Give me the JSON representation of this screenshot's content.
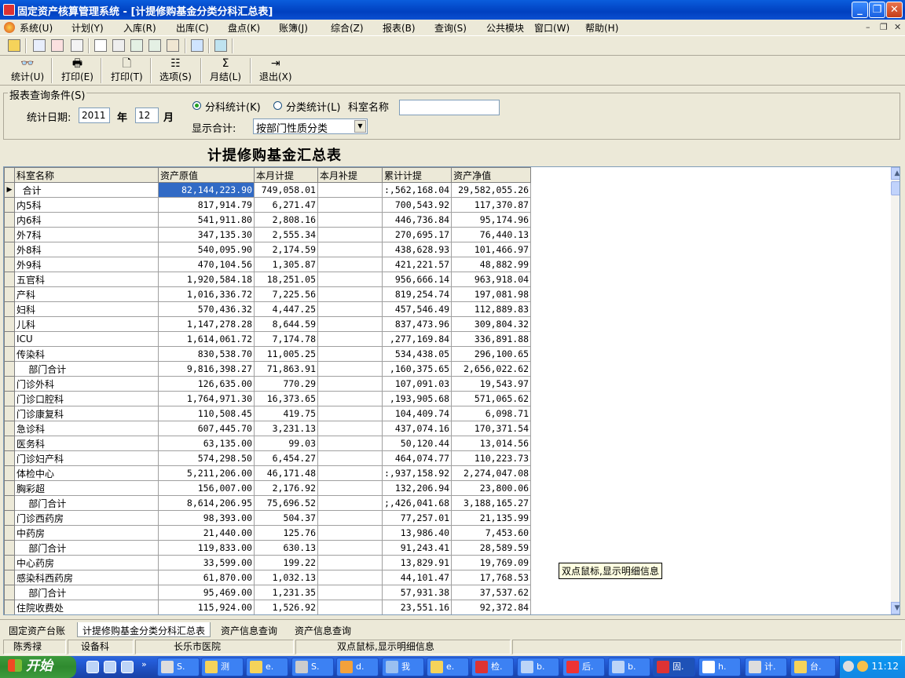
{
  "window": {
    "title": "固定资产核算管理系统 - [计提修购基金分类分科汇总表]"
  },
  "menu": [
    "系统(U)",
    "计划(Y)",
    "入库(R)",
    "出库(C)",
    "盘点(K)",
    "账簿(J)",
    "综合(Z)",
    "报表(B)",
    "查询(S)",
    "公共模块",
    "窗口(W)",
    "帮助(H)"
  ],
  "toolbar2": [
    {
      "label": "统计(U)",
      "icon": "binoculars-icon"
    },
    {
      "label": "打印(E)",
      "icon": "printer-icon"
    },
    {
      "label": "打印(T)",
      "icon": "print-preview-icon"
    },
    {
      "label": "选项(S)",
      "icon": "options-icon"
    },
    {
      "label": "月结(L)",
      "icon": "sigma-icon"
    },
    {
      "label": "退出(X)",
      "icon": "exit-door-icon"
    }
  ],
  "query": {
    "legend": "报表查询条件(S)",
    "date_label": "统计日期:",
    "year": "2011",
    "year_unit": "年",
    "month": "12",
    "month_unit": "月",
    "radio_dept": "分科统计(K)",
    "radio_class": "分类统计(L)",
    "dept_name_label": "科室名称",
    "dept_name_value": "",
    "total_label": "显示合计:",
    "total_option": "按部门性质分类"
  },
  "report": {
    "title": "计提修购基金汇总表",
    "columns": [
      "科室名称",
      "资产原值",
      "本月计提",
      "本月补提",
      "累计计提",
      "资产净值"
    ],
    "rows": [
      [
        "  合计",
        "82,144,223.90",
        "749,058.01",
        "",
        ":,562,168.04",
        "29,582,055.26"
      ],
      [
        "内5科",
        "817,914.79",
        "6,271.47",
        "",
        "700,543.92",
        "117,370.87"
      ],
      [
        "内6科",
        "541,911.80",
        "2,808.16",
        "",
        "446,736.84",
        "95,174.96"
      ],
      [
        "外7科",
        "347,135.30",
        "2,555.34",
        "",
        "270,695.17",
        "76,440.13"
      ],
      [
        "外8科",
        "540,095.90",
        "2,174.59",
        "",
        "438,628.93",
        "101,466.97"
      ],
      [
        "外9科",
        "470,104.56",
        "1,305.87",
        "",
        "421,221.57",
        "48,882.99"
      ],
      [
        "五官科",
        "1,920,584.18",
        "18,251.05",
        "",
        "956,666.14",
        "963,918.04"
      ],
      [
        "产科",
        "1,016,336.72",
        "7,225.56",
        "",
        "819,254.74",
        "197,081.98"
      ],
      [
        "妇科",
        "570,436.32",
        "4,447.25",
        "",
        "457,546.49",
        "112,889.83"
      ],
      [
        "儿科",
        "1,147,278.28",
        "8,644.59",
        "",
        "837,473.96",
        "309,804.32"
      ],
      [
        "ICU",
        "1,614,061.72",
        "7,174.78",
        "",
        ",277,169.84",
        "336,891.88"
      ],
      [
        "传染科",
        "830,538.70",
        "11,005.25",
        "",
        "534,438.05",
        "296,100.65"
      ],
      [
        "    部门合计",
        "9,816,398.27",
        "71,863.91",
        "",
        ",160,375.65",
        "2,656,022.62"
      ],
      [
        "门诊外科",
        "126,635.00",
        "770.29",
        "",
        "107,091.03",
        "19,543.97"
      ],
      [
        "门诊口腔科",
        "1,764,971.30",
        "16,373.65",
        "",
        ",193,905.68",
        "571,065.62"
      ],
      [
        "门诊康复科",
        "110,508.45",
        "419.75",
        "",
        "104,409.74",
        "6,098.71"
      ],
      [
        "急诊科",
        "607,445.70",
        "3,231.13",
        "",
        "437,074.16",
        "170,371.54"
      ],
      [
        "医务科",
        "63,135.00",
        "99.03",
        "",
        "50,120.44",
        "13,014.56"
      ],
      [
        "门诊妇产科",
        "574,298.50",
        "6,454.27",
        "",
        "464,074.77",
        "110,223.73"
      ],
      [
        "体检中心",
        "5,211,206.00",
        "46,171.48",
        "",
        ":,937,158.92",
        "2,274,047.08"
      ],
      [
        "胸彩超",
        "156,007.00",
        "2,176.92",
        "",
        "132,206.94",
        "23,800.06"
      ],
      [
        "    部门合计",
        "8,614,206.95",
        "75,696.52",
        "",
        ";,426,041.68",
        "3,188,165.27"
      ],
      [
        "门诊西药房",
        "98,393.00",
        "504.37",
        "",
        "77,257.01",
        "21,135.99"
      ],
      [
        "中药房",
        "21,440.00",
        "125.76",
        "",
        "13,986.40",
        "7,453.60"
      ],
      [
        "    部门合计",
        "119,833.00",
        "630.13",
        "",
        "91,243.41",
        "28,589.59"
      ],
      [
        "中心药房",
        "33,599.00",
        "199.22",
        "",
        "13,829.91",
        "19,769.09"
      ],
      [
        "感染科西药房",
        "61,870.00",
        "1,032.13",
        "",
        "44,101.47",
        "17,768.53"
      ],
      [
        "    部门合计",
        "95,469.00",
        "1,231.35",
        "",
        "57,931.38",
        "37,537.62"
      ],
      [
        "住院收费处",
        "115,924.00",
        "1,526.92",
        "",
        "23,551.16",
        "92,372.84"
      ]
    ]
  },
  "tooltip": "双点鼠标,显示明细信息",
  "tabs": [
    "固定资产台账",
    "计提修购基金分类分科汇总表",
    "资产信息查询",
    "资产信息查询"
  ],
  "status": [
    "陈秀禄",
    "设备科",
    "长乐市医院",
    "双点鼠标,显示明细信息",
    ""
  ],
  "taskbar": {
    "start": "开始",
    "tasks": [
      "S.",
      "测",
      "e.",
      "S.",
      "d.",
      "我",
      "e.",
      "检.",
      "b.",
      "后.",
      "b.",
      "固.",
      "h.",
      "计.",
      "台."
    ],
    "clock": "11:12"
  },
  "colors": {
    "title_blue": "#0a5ddc",
    "selected_cell": "#316ac5",
    "tooltip_bg": "#ffffe1",
    "start_green": "#3c9a3c"
  }
}
